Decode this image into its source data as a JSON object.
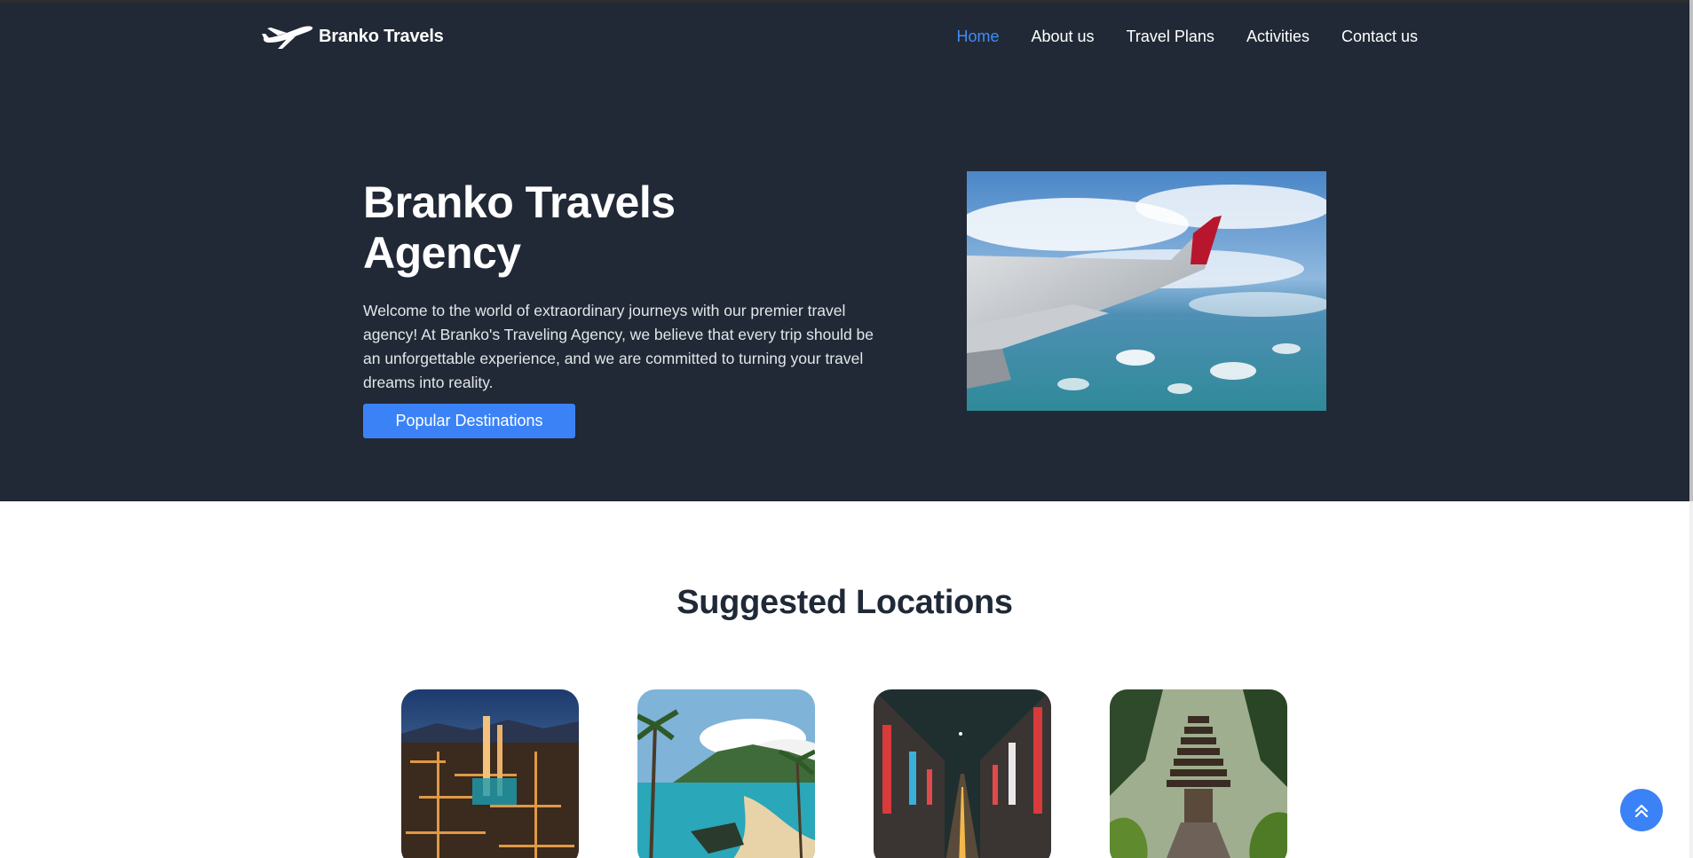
{
  "nav": {
    "brand_name": "Branko Travels",
    "brand_icon": "airplane-icon",
    "links": [
      {
        "label": "Home",
        "active": true
      },
      {
        "label": "About us",
        "active": false
      },
      {
        "label": "Travel Plans",
        "active": false
      },
      {
        "label": "Activities",
        "active": false
      },
      {
        "label": "Contact us",
        "active": false
      }
    ]
  },
  "hero": {
    "title_line1": "Branko Travels",
    "title_line2": "Agency",
    "text": "Welcome to the world of extraordinary journeys with our premier travel agency! At Branko's Traveling Agency, we believe that every trip should be an unforgettable experience, and we are committed to turning your travel dreams into reality.",
    "button_label": "Popular Destinations",
    "image_alt": "airplane-wing-over-sea-photo"
  },
  "locations": {
    "title": "Suggested Locations",
    "cards": [
      {
        "image": "city-at-night-aerial-photo"
      },
      {
        "image": "tropical-beach-photo"
      },
      {
        "image": "neon-city-street-photo"
      },
      {
        "image": "jungle-temple-photo"
      }
    ]
  },
  "scroll_top": {
    "icon": "double-chevron-up-icon"
  },
  "colors": {
    "hero_bg": "#212936",
    "accent": "#3b82f6",
    "nav_active": "#3f8cf5",
    "section_title": "#1f2937"
  }
}
